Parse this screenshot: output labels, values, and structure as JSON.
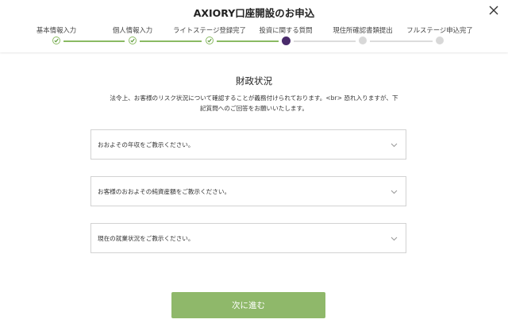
{
  "header": {
    "title": "AXIORY口座開設のお申込",
    "close_icon": "close-icon"
  },
  "steps": [
    {
      "label": "基本情報入力",
      "state": "done"
    },
    {
      "label": "個人情報入力",
      "state": "done"
    },
    {
      "label": "ライトステージ登録完了",
      "state": "done"
    },
    {
      "label": "投資に関する質問",
      "state": "current"
    },
    {
      "label": "現住所確認書類提出",
      "state": "todo"
    },
    {
      "label": "フルステージ申込完了",
      "state": "todo"
    }
  ],
  "main": {
    "section_title": "財政状況",
    "description_line1": "法令上、お客様のリスク状況について確認することが義務付けられております。<br> 恐れ入りますが、下",
    "description_line2": "記質問へのご回答をお願いいたします。",
    "questions": [
      {
        "label": "おおよその年収をご教示ください。",
        "value": ""
      },
      {
        "label": "お客様のおおよその純資産額をご教示ください。",
        "value": ""
      },
      {
        "label": "現在の就業状況をご教示ください。",
        "value": ""
      }
    ],
    "next_button_label": "次に進む"
  },
  "colors": {
    "done": "#8aba63",
    "current": "#4a2b6b",
    "todo": "#d8d8d8",
    "button": "#8fb86a"
  }
}
